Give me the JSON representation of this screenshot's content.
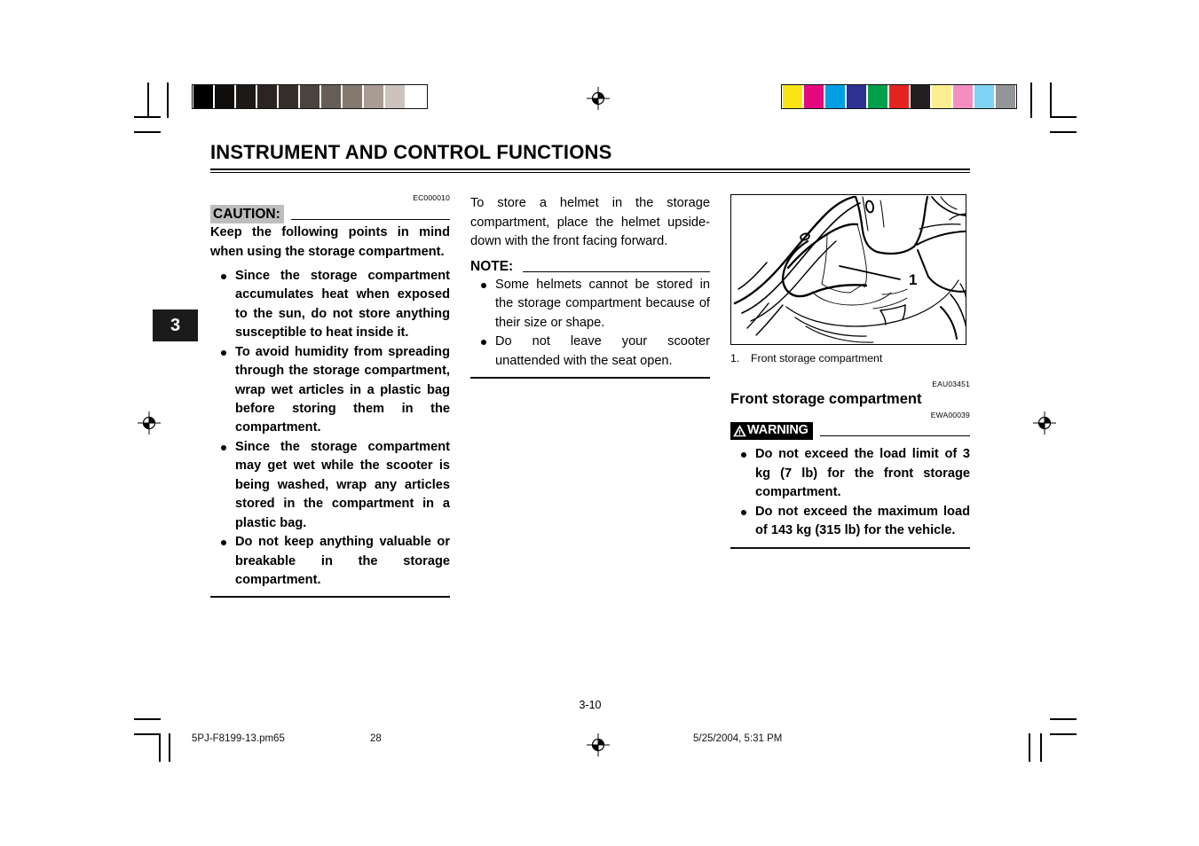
{
  "document": {
    "chapter_title": "INSTRUMENT AND CONTROL FUNCTIONS",
    "chapter_tab": "3",
    "page_number": "3-10"
  },
  "left_column": {
    "doc_code": "EC000010",
    "header": "CAUTION:",
    "lead_paragraph": "Keep the following points in mind when using the storage compartment.",
    "bullets": [
      "Since the storage compartment accumulates heat when exposed to the sun, do not store anything susceptible to heat inside it.",
      "To avoid humidity from spreading through the storage compartment, wrap wet articles in a plastic bag before storing them in the compartment.",
      "Since the storage compartment may get wet while the scooter is being washed, wrap any articles stored in the compartment in a plastic bag.",
      "Do not keep anything valuable or breakable in the storage compartment."
    ]
  },
  "middle_column": {
    "intro_paragraph": "To store a helmet in the storage compartment, place the helmet upside-down with the front facing forward.",
    "note_header": "NOTE:",
    "note_bullets": [
      "Some helmets cannot be stored in the storage compartment because of their size or shape.",
      "Do not leave your scooter unattended with the seat open."
    ]
  },
  "right_column": {
    "figure_callout": "1",
    "figure_caption_number": "1.",
    "figure_caption_text": "Front storage compartment",
    "section_doc_code": "EAU03451",
    "section_heading": "Front storage compartment",
    "warning_doc_code": "EWA00039",
    "warning_header": "WARNING",
    "warning_bullets": [
      "Do not exceed the load limit of 3 kg (7 lb) for the front storage compartment.",
      "Do not exceed the maximum load of 143 kg (315 lb) for the vehicle."
    ]
  },
  "print_footer": {
    "file_name": "5PJ-F8199-13.pm65",
    "sheet_number": "28",
    "timestamp": "5/25/2004, 5:31 PM"
  },
  "calibration": {
    "gray_patches": [
      "#000000",
      "#100d0d",
      "#1d1917",
      "#2a2522",
      "#36302c",
      "#4b433e",
      "#665d57",
      "#85796f",
      "#a89c94",
      "#cdc3bc",
      "#ffffff"
    ],
    "color_patches": [
      "#fbe415",
      "#e5097f",
      "#00a0e3",
      "#2e3192",
      "#00a04b",
      "#e52421",
      "#231f20",
      "#fdee92",
      "#f48fc0",
      "#7fd4f5",
      "#939598"
    ]
  }
}
